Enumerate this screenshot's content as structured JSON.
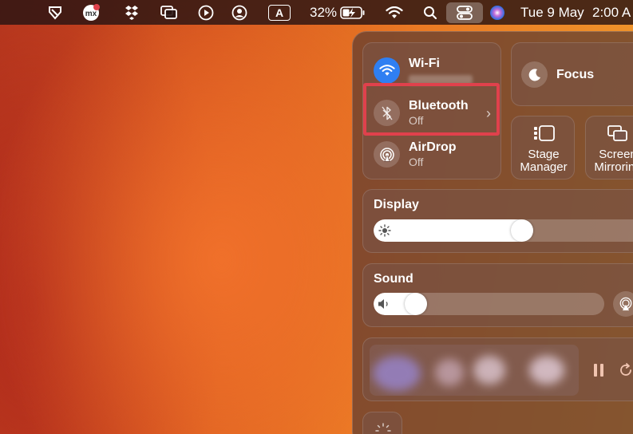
{
  "menubar": {
    "battery_percent": "32%",
    "date": "Tue 9 May",
    "time": "2:00 A",
    "input_source": "A",
    "icons": [
      "scissors-icon",
      "mx-app-icon",
      "dropbox-icon",
      "window-stack-icon",
      "play-icon",
      "user-circle-icon",
      "input-source-icon",
      "battery-charging-icon",
      "wifi-icon",
      "search-icon",
      "control-center-icon",
      "siri-icon"
    ]
  },
  "control_center": {
    "wifi": {
      "title": "Wi-Fi",
      "icon": "wifi-icon"
    },
    "bluetooth": {
      "title": "Bluetooth",
      "status": "Off",
      "icon": "bluetooth-icon"
    },
    "airdrop": {
      "title": "AirDrop",
      "status": "Off",
      "icon": "airdrop-icon"
    },
    "focus": {
      "label": "Focus",
      "icon": "moon-icon"
    },
    "stage_manager": {
      "line1": "Stage",
      "line2": "Manager",
      "icon": "stage-manager-icon"
    },
    "screen_mirroring": {
      "line1": "Screen",
      "line2": "Mirroring",
      "icon": "screen-mirroring-icon"
    },
    "display": {
      "title": "Display",
      "brightness": 0.55
    },
    "sound": {
      "title": "Sound",
      "volume": 0.15
    },
    "now_playing": {
      "controls": [
        "pause-icon",
        "refresh-icon"
      ]
    }
  },
  "colors": {
    "highlight": "#e0414c",
    "wifi_blue": "#2f7ff2"
  }
}
